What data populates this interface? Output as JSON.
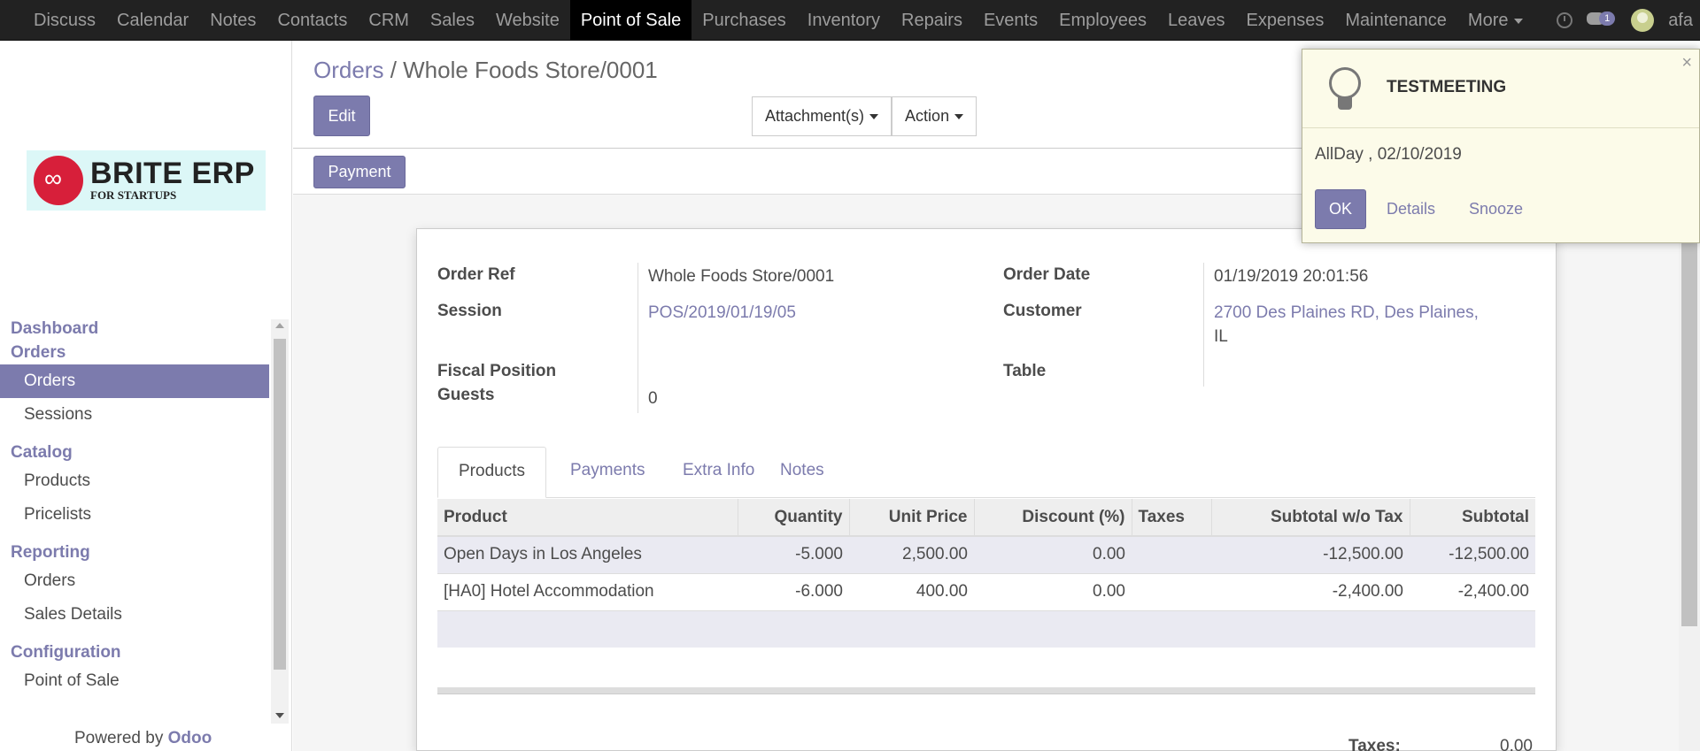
{
  "topbar": {
    "menu": [
      "Discuss",
      "Calendar",
      "Notes",
      "Contacts",
      "CRM",
      "Sales",
      "Website",
      "Point of Sale",
      "Purchases",
      "Inventory",
      "Repairs",
      "Events",
      "Employees",
      "Leaves",
      "Expenses",
      "Maintenance"
    ],
    "more": "More",
    "chat_badge": "1",
    "user": "afa"
  },
  "logo": {
    "title": "BRITE ERP",
    "subtitle": "FOR STARTUPS"
  },
  "sidebar": {
    "dashboard": "Dashboard",
    "orders_section": "Orders",
    "orders": "Orders",
    "sessions": "Sessions",
    "catalog": "Catalog",
    "products": "Products",
    "pricelists": "Pricelists",
    "reporting": "Reporting",
    "rep_orders": "Orders",
    "sales_details": "Sales Details",
    "configuration": "Configuration",
    "point_of_sale": "Point of Sale",
    "powered_prefix": "Powered by ",
    "powered_brand": "Odoo"
  },
  "breadcrumb": {
    "parent": "Orders",
    "sep": " / ",
    "current": "Whole Foods Store/0001"
  },
  "buttons": {
    "edit": "Edit",
    "attachments": "Attachment(s)",
    "action": "Action",
    "payment": "Payment"
  },
  "form": {
    "order_ref_label": "Order Ref",
    "order_ref": "Whole Foods Store/0001",
    "session_label": "Session",
    "session": "POS/2019/01/19/05",
    "fiscal_label": "Fiscal Position",
    "guests_label": "Guests",
    "guests": "0",
    "order_date_label": "Order Date",
    "order_date": "01/19/2019 20:01:56",
    "customer_label": "Customer",
    "customer_line1": "2700 Des Plaines RD, Des Plaines,",
    "customer_line2": "IL",
    "table_label": "Table"
  },
  "tabs": [
    "Products",
    "Payments",
    "Extra Info",
    "Notes"
  ],
  "table": {
    "headers": [
      "Product",
      "Quantity",
      "Unit Price",
      "Discount (%)",
      "Taxes",
      "Subtotal w/o Tax",
      "Subtotal"
    ],
    "rows": [
      [
        "Open Days in Los Angeles",
        "-5.000",
        "2,500.00",
        "0.00",
        "",
        "-12,500.00",
        "-12,500.00"
      ],
      [
        "[HA0] Hotel Accommodation",
        "-6.000",
        "400.00",
        "0.00",
        "",
        "-2,400.00",
        "-2,400.00"
      ]
    ]
  },
  "totals": {
    "taxes_label": "Taxes:",
    "taxes": "0.00"
  },
  "notification": {
    "title": "TESTMEETING",
    "when": "AllDay , 02/10/2019",
    "ok": "OK",
    "details": "Details",
    "snooze": "Snooze",
    "close": "×"
  }
}
